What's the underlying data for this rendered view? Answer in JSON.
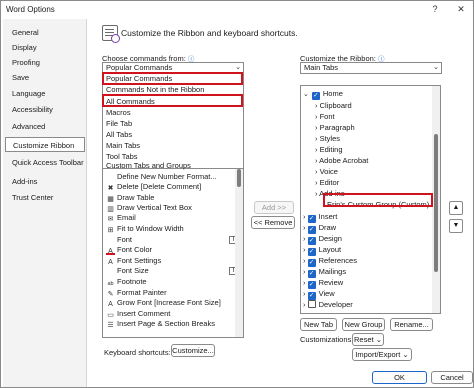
{
  "window": {
    "title": "Word Options",
    "help_glyph": "?",
    "close_glyph": "✕"
  },
  "sidebar": {
    "items": [
      {
        "label": "General"
      },
      {
        "label": "Display"
      },
      {
        "label": "Proofing"
      },
      {
        "label": "Save"
      },
      {
        "label": "Language"
      },
      {
        "label": "Accessibility"
      },
      {
        "label": "Advanced"
      },
      {
        "label": "Customize Ribbon",
        "active": true
      },
      {
        "label": "Quick Access Toolbar"
      },
      {
        "label": "Add-ins"
      },
      {
        "label": "Trust Center"
      }
    ]
  },
  "main": {
    "heading": "Customize the Ribbon and keyboard shortcuts.",
    "choose_label": "Choose commands from:",
    "choose_value": "Popular Commands",
    "customize_label": "Customize the Ribbon:",
    "customize_value": "Main Tabs",
    "info_glyph": "ⓘ",
    "dropdown_glyph": "⌄"
  },
  "dropdown_options": [
    "Popular Commands",
    "Commands Not in the Ribbon",
    "All Commands",
    "Macros",
    "File Tab",
    "All Tabs",
    "Main Tabs",
    "Tool Tabs",
    "Custom Tabs and Groups"
  ],
  "commands_list": [
    {
      "label": "Define New Number Format...",
      "icon": ""
    },
    {
      "label": "Delete [Delete Comment]",
      "icon": "✖"
    },
    {
      "label": "Draw Table",
      "icon": "▦"
    },
    {
      "label": "Draw Vertical Text Box",
      "icon": "▥"
    },
    {
      "label": "Email",
      "icon": "✉"
    },
    {
      "label": "Fit to Window Width",
      "icon": "⊞"
    },
    {
      "label": "Font",
      "icon": "",
      "trailing": "Ⅰ"
    },
    {
      "label": "Font Color",
      "icon": "A"
    },
    {
      "label": "Font Settings",
      "icon": "A"
    },
    {
      "label": "Font Size",
      "icon": "",
      "trailing": "Ⅰ"
    },
    {
      "label": "Footnote",
      "icon": "ab"
    },
    {
      "label": "Format Painter",
      "icon": "✎"
    },
    {
      "label": "Grow Font [Increase Font Size]",
      "icon": "A"
    },
    {
      "label": "Insert Comment",
      "icon": "▭"
    },
    {
      "label": "Insert Page & Section Breaks",
      "icon": "☰"
    }
  ],
  "ribbon_tree": [
    {
      "label": "Home",
      "level": 0,
      "checked": true,
      "expanded": true
    },
    {
      "label": "Clipboard",
      "level": 1
    },
    {
      "label": "Font",
      "level": 1
    },
    {
      "label": "Paragraph",
      "level": 1
    },
    {
      "label": "Styles",
      "level": 1
    },
    {
      "label": "Editing",
      "level": 1
    },
    {
      "label": "Adobe Acrobat",
      "level": 1
    },
    {
      "label": "Voice",
      "level": 1
    },
    {
      "label": "Editor",
      "level": 1
    },
    {
      "label": "Add-ins",
      "level": 1
    },
    {
      "label": "Erin's Custom Group (Custom)",
      "level": 2,
      "highlighted": true
    },
    {
      "label": "Insert",
      "level": 0,
      "checked": true
    },
    {
      "label": "Draw",
      "level": 0,
      "checked": true
    },
    {
      "label": "Design",
      "level": 0,
      "checked": true
    },
    {
      "label": "Layout",
      "level": 0,
      "checked": true
    },
    {
      "label": "References",
      "level": 0,
      "checked": true
    },
    {
      "label": "Mailings",
      "level": 0,
      "checked": true
    },
    {
      "label": "Review",
      "level": 0,
      "checked": true
    },
    {
      "label": "View",
      "level": 0,
      "checked": true
    },
    {
      "label": "Developer",
      "level": 0,
      "checked": false
    }
  ],
  "buttons": {
    "add": "Add >>",
    "remove": "<< Remove",
    "new_tab": "New Tab",
    "new_group": "New Group",
    "rename": "Rename...",
    "reset": "Reset",
    "import_export": "Import/Export",
    "customize": "Customize...",
    "ok": "OK",
    "cancel": "Cancel",
    "move_up": "▲",
    "move_down": "▼"
  },
  "labels": {
    "customizations": "Customizations:",
    "keyboard_shortcuts": "Keyboard shortcuts:"
  },
  "colors": {
    "accent": "#1e66c8",
    "highlight": "#d0141e"
  }
}
